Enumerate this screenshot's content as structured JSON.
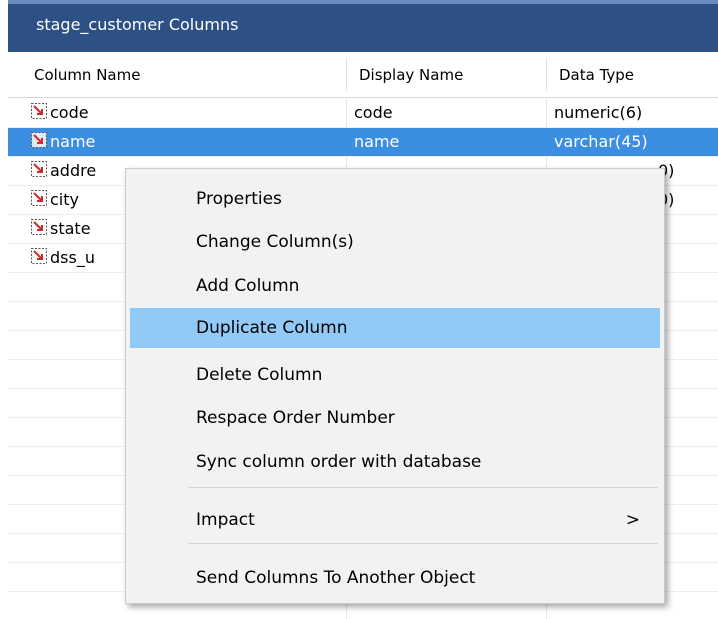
{
  "window": {
    "title": "stage_customer Columns"
  },
  "columns": [
    "Column Name",
    "Display Name",
    "Data Type"
  ],
  "rows": [
    {
      "name": "code",
      "display": "code",
      "type": "numeric(6)",
      "selected": false
    },
    {
      "name": "name",
      "display": "name",
      "type": "varchar(45)",
      "selected": true
    },
    {
      "name": "addre",
      "display": "",
      "type": "0)",
      "selected": false
    },
    {
      "name": "city",
      "display": "",
      "type": "0)",
      "selected": false
    },
    {
      "name": "state",
      "display": "",
      "type": "",
      "selected": false
    },
    {
      "name": "dss_u",
      "display": "",
      "type": "",
      "selected": false
    }
  ],
  "row_icon": "column-icon",
  "context_menu": {
    "items": [
      {
        "label": "Properties"
      },
      {
        "label": "Change Column(s)"
      },
      {
        "label": "Add Column"
      },
      {
        "label": "Duplicate Column",
        "hover": true
      },
      {
        "label": "Delete Column"
      },
      {
        "label": "Respace Order Number"
      },
      {
        "label": "Sync column order with database"
      },
      {
        "label": "Impact",
        "submenu": true,
        "submenu_icon": "chevron-right-icon"
      },
      {
        "label": "Send Columns To Another Object"
      }
    ],
    "submenu_glyph": ">"
  },
  "colors": {
    "titlebar": "#2d5185",
    "selection": "#3c8ee3",
    "menu_hover": "#91c9f7",
    "icon_arrow": "#d12a2a"
  }
}
